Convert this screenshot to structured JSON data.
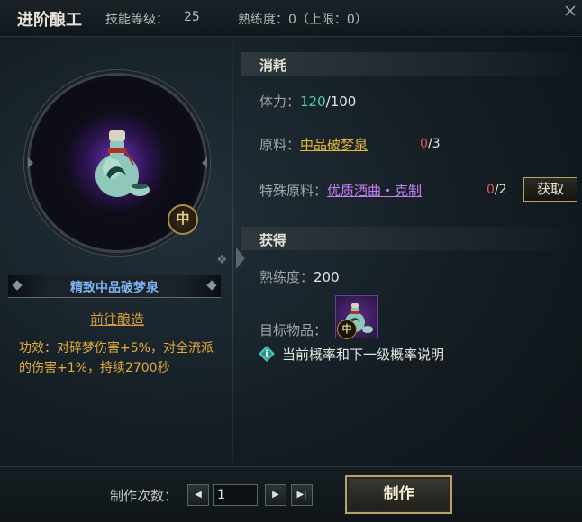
{
  "header": {
    "title": "进阶酿工",
    "skill_level_label": "技能等级：",
    "skill_level_value": "25",
    "proficiency_text": "熟练度：0（上限：0）"
  },
  "item": {
    "name": "精致中品破梦泉",
    "grade": "中",
    "goto_label": "前往酿造",
    "effect": "功效：对碎梦伤害+5%，对全流派的伤害+1%，持续2700秒"
  },
  "consume": {
    "section_title": "消耗",
    "stamina_label": "体力：",
    "stamina_current": "120",
    "stamina_max": "/100",
    "material_label": "原料：",
    "material_name": "中品破梦泉",
    "material_have": "0",
    "material_need": "/3",
    "special_label": "特殊原料：",
    "special_name": "优质酒曲・克制",
    "special_have": "0",
    "special_need": "/2",
    "acquire_button": "获取"
  },
  "obtain": {
    "section_title": "获得",
    "proficiency_label": "熟练度：",
    "proficiency_value": "200",
    "target_label": "目标物品：",
    "target_grade": "中",
    "probability_text": "当前概率和下一级概率说明"
  },
  "craft": {
    "count_label": "制作次数：",
    "count_value": "1",
    "craft_button": "制作"
  },
  "colors": {
    "accent_gold": "#e4ac3b",
    "stamina_green": "#4fd1a6",
    "deficit_red": "#e0544e",
    "material_yellow": "#e6b93a",
    "special_purple": "#c581f0",
    "item_name_blue": "#7fb2f0"
  },
  "icons": [
    "close-icon",
    "wine-jar-icon",
    "grade-badge-icon",
    "diamond-info-icon",
    "triangle-left-icon",
    "triangle-right-icon",
    "skip-end-icon"
  ]
}
